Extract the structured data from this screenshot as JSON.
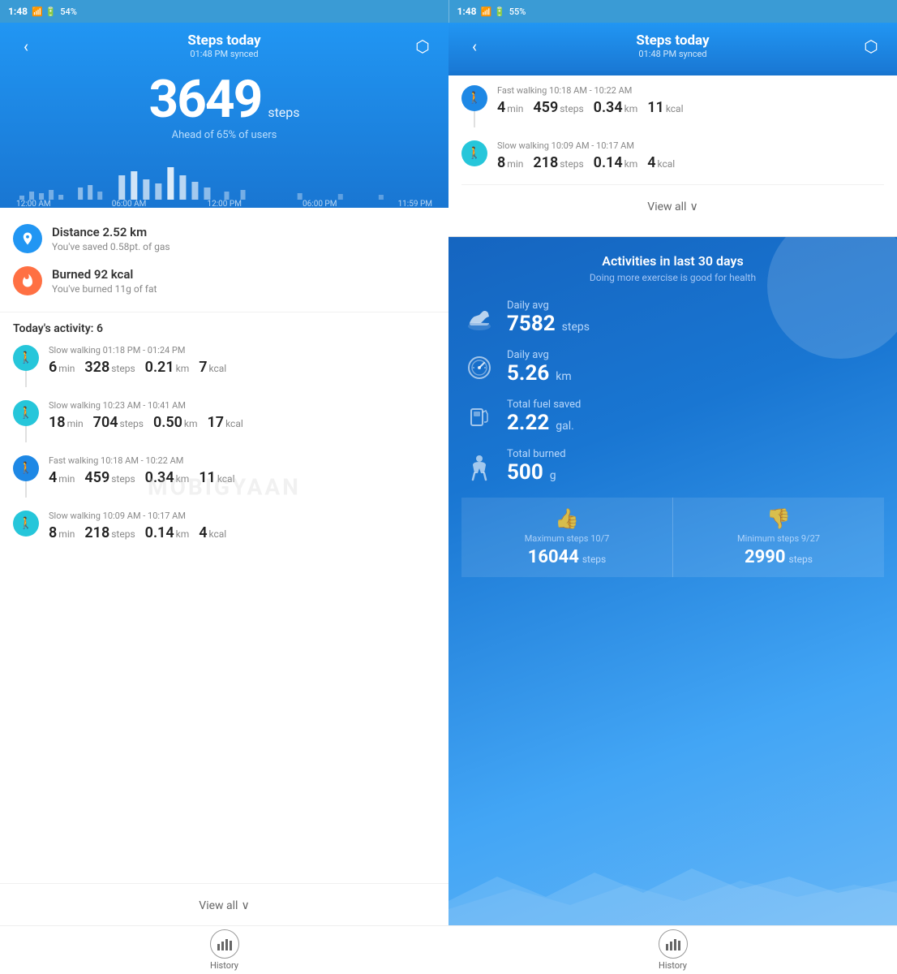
{
  "left": {
    "status": {
      "time": "1:48",
      "battery": "54%"
    },
    "header": {
      "title": "Steps today",
      "subtitle": "01:48 PM synced",
      "back_icon": "‹",
      "export_icon": "⬡"
    },
    "steps": {
      "count": "3649",
      "unit": "steps",
      "ahead_text": "Ahead of 65% of users"
    },
    "chart": {
      "labels": [
        "12:00 AM",
        "06:00 AM",
        "12:00 PM",
        "06:00 PM",
        "11:59 PM"
      ]
    },
    "stats": [
      {
        "icon": "📍",
        "title": "Distance 2.52 km",
        "desc": "You've saved 0.58pt. of gas",
        "color": "blue"
      },
      {
        "icon": "🔥",
        "title": "Burned 92 kcal",
        "desc": "You've burned 11g of fat",
        "color": "orange"
      }
    ],
    "activity": {
      "header": "Today's activity: 6",
      "items": [
        {
          "type": "Slow walking",
          "time": "01:18 PM - 01:24 PM",
          "duration": "6",
          "duration_unit": "min",
          "steps": "328",
          "steps_unit": "steps",
          "distance": "0.21",
          "distance_unit": "km",
          "kcal": "7",
          "kcal_unit": "kcal",
          "color": "teal"
        },
        {
          "type": "Slow walking",
          "time": "10:23 AM - 10:41 AM",
          "duration": "18",
          "duration_unit": "min",
          "steps": "704",
          "steps_unit": "steps",
          "distance": "0.50",
          "distance_unit": "km",
          "kcal": "17",
          "kcal_unit": "kcal",
          "color": "teal"
        },
        {
          "type": "Fast walking",
          "time": "10:18 AM - 10:22 AM",
          "duration": "4",
          "duration_unit": "min",
          "steps": "459",
          "steps_unit": "steps",
          "distance": "0.34",
          "distance_unit": "km",
          "kcal": "11",
          "kcal_unit": "kcal",
          "color": "blue"
        },
        {
          "type": "Slow walking",
          "time": "10:09 AM - 10:17 AM",
          "duration": "8",
          "duration_unit": "min",
          "steps": "218",
          "steps_unit": "steps",
          "distance": "0.14",
          "distance_unit": "km",
          "kcal": "4",
          "kcal_unit": "kcal",
          "color": "teal"
        }
      ]
    },
    "view_all": "View all",
    "bottom_nav": {
      "label": "History"
    }
  },
  "right": {
    "status": {
      "time": "1:48",
      "battery": "55%"
    },
    "header": {
      "title": "Steps today",
      "subtitle": "01:48 PM synced"
    },
    "popup": {
      "items": [
        {
          "type": "Fast walking",
          "time": "10:18 AM - 10:22 AM",
          "duration": "4",
          "duration_unit": "min",
          "steps": "459",
          "steps_unit": "steps",
          "distance": "0.34",
          "distance_unit": "km",
          "kcal": "11",
          "kcal_unit": "kcal",
          "color": "blue"
        },
        {
          "type": "Slow walking",
          "time": "10:09 AM - 10:17 AM",
          "duration": "8",
          "duration_unit": "min",
          "steps": "218",
          "steps_unit": "steps",
          "distance": "0.14",
          "distance_unit": "km",
          "kcal": "4",
          "kcal_unit": "kcal",
          "color": "teal"
        }
      ],
      "view_all": "View all"
    },
    "activities": {
      "title": "Activities in last 30 days",
      "subtitle": "Doing more exercise is good for health",
      "metrics": [
        {
          "label": "Daily avg",
          "value": "7582",
          "unit": "steps",
          "icon_type": "shoe"
        },
        {
          "label": "Daily avg",
          "value": "5.26",
          "unit": "km",
          "icon_type": "clock"
        },
        {
          "label": "Total fuel saved",
          "value": "2.22",
          "unit": "gal.",
          "icon_type": "fuel"
        },
        {
          "label": "Total burned",
          "value": "500",
          "unit": "g",
          "icon_type": "body"
        }
      ],
      "bottom_stats": [
        {
          "label": "Maximum steps 10/7",
          "value": "16044",
          "unit": "steps",
          "icon": "👍"
        },
        {
          "label": "Minimum steps 9/27",
          "value": "2990",
          "unit": "steps",
          "icon": "👎"
        }
      ]
    },
    "bottom_nav": {
      "label": "History"
    }
  },
  "watermark": "MOBIGYAAN"
}
